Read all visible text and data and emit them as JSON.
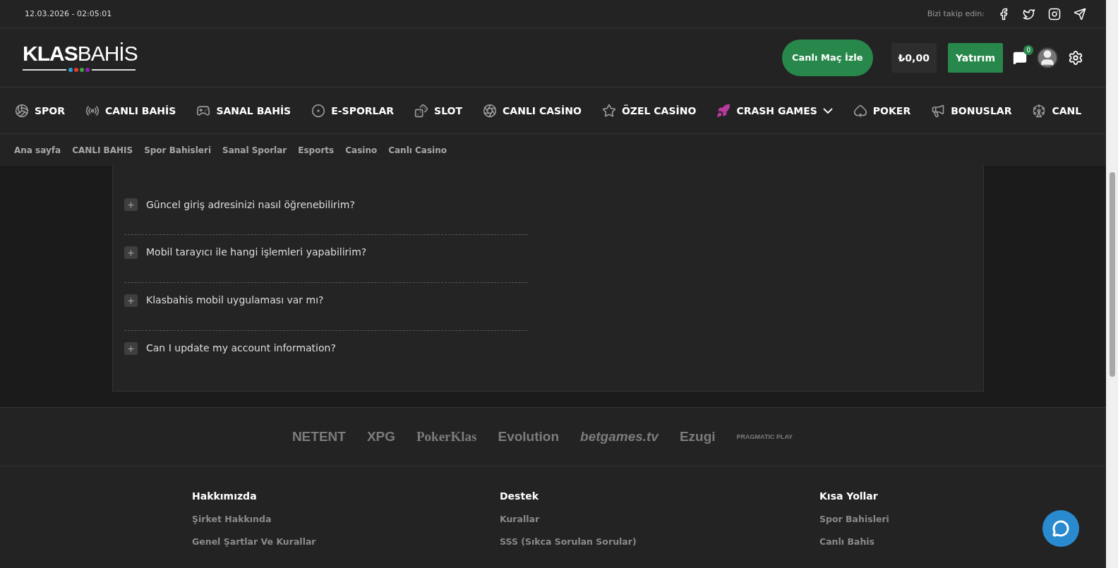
{
  "top_bar": {
    "datetime": "12.03.2026 - 02:05:01",
    "follow_label": "Bizi takip edin:"
  },
  "header": {
    "logo_bold": "KLAS",
    "logo_light": "BAHİS",
    "live_button": "Canlı Maç İzle",
    "balance": "₺0,00",
    "deposit_button": "Yatırım",
    "messages_badge": "0"
  },
  "nav": [
    {
      "label": "SPOR",
      "dropdown": false
    },
    {
      "label": "CANLI BAHİS",
      "dropdown": false
    },
    {
      "label": "SANAL BAHİS",
      "dropdown": false
    },
    {
      "label": "E-SPORLAR",
      "dropdown": false
    },
    {
      "label": "SLOT",
      "dropdown": false
    },
    {
      "label": "CANLI CASİNO",
      "dropdown": false
    },
    {
      "label": "ÖZEL CASİNO",
      "dropdown": false
    },
    {
      "label": "CRASH GAMES",
      "dropdown": true
    },
    {
      "label": "POKER",
      "dropdown": false
    },
    {
      "label": "BONUSLAR",
      "dropdown": false
    },
    {
      "label": "CANL",
      "dropdown": false
    }
  ],
  "breadcrumbs": [
    "Ana sayfa",
    "CANLI BAHIS",
    "Spor Bahisleri",
    "Sanal Sporlar",
    "Esports",
    "Casino",
    "Canlı Casino"
  ],
  "faq": {
    "items": [
      {
        "question": "Güncel giriş adresinizi nasıl öğrenebilirim?",
        "expanded": false
      },
      {
        "question": "Mobil tarayıcı ile hangi işlemleri yapabilirim?",
        "expanded": false
      },
      {
        "question": "Klasbahis mobil uygulaması var mı?",
        "expanded": false
      },
      {
        "question": "Can I update my account information?",
        "expanded": false
      }
    ]
  },
  "providers": [
    "NETENT",
    "XPG",
    "PokerKlas",
    "Evolution",
    "betgames.tv",
    "Ezugi",
    "PRAGMATIC PLAY"
  ],
  "footer": [
    {
      "title": "Hakkımızda",
      "links": [
        "Şirket Hakkında",
        "Genel Şartlar Ve Kurallar"
      ]
    },
    {
      "title": "Destek",
      "links": [
        "Kurallar",
        "SSS (Sıkca Sorulan Sorular)"
      ]
    },
    {
      "title": "Kısa Yollar",
      "links": [
        "Spor Bahisleri",
        "Canlı Bahis"
      ]
    }
  ]
}
